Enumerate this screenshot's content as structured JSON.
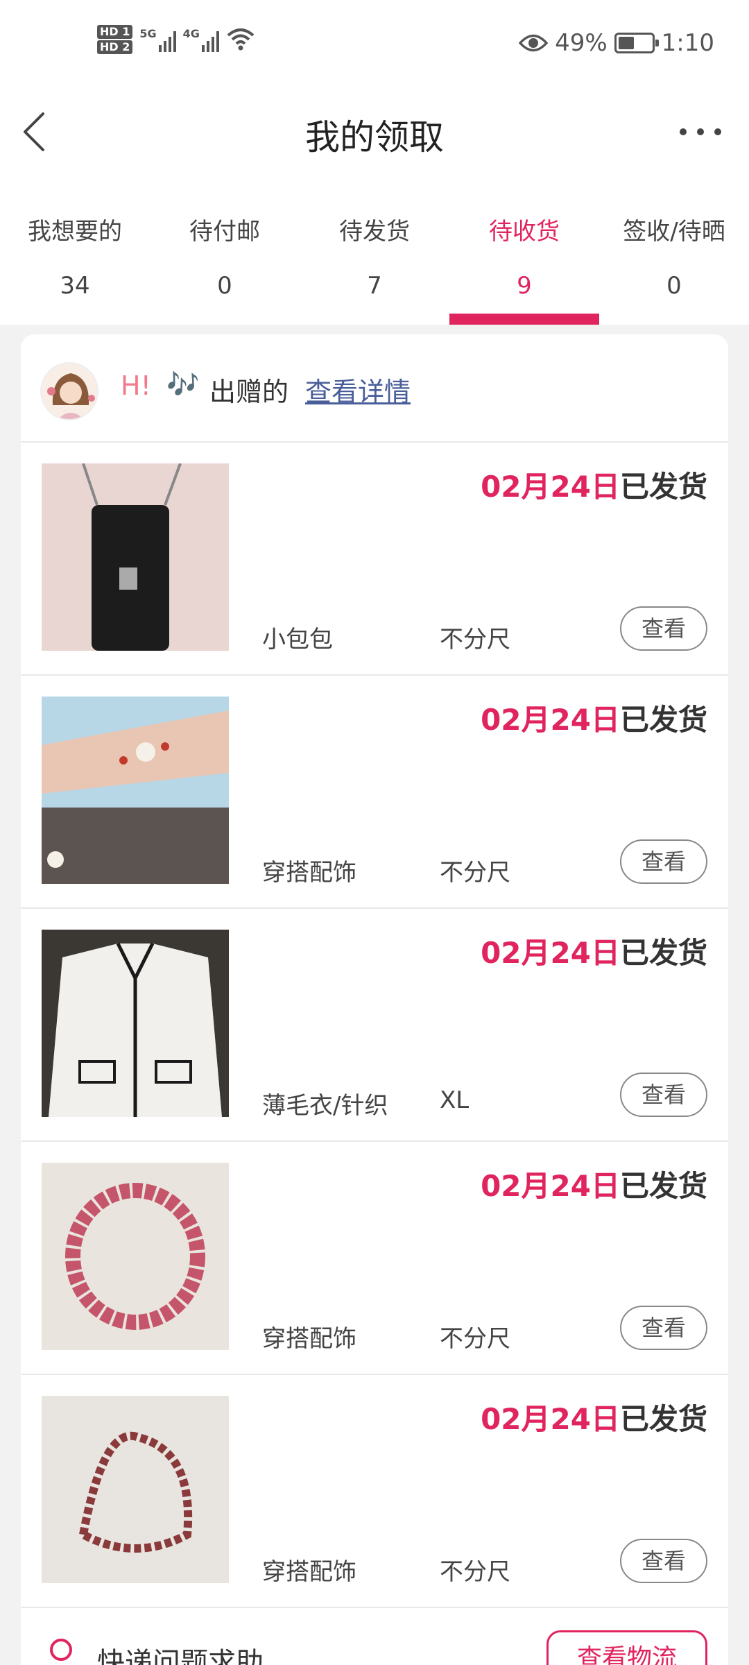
{
  "status_bar": {
    "sim1": "HD 1",
    "sim2": "HD 2",
    "net1": "5G",
    "net2": "4G",
    "battery": "49%",
    "battery_level": 0.49,
    "time": "1:10"
  },
  "header": {
    "title": "我的领取"
  },
  "tabs": [
    {
      "label": "我想要的",
      "count": "34"
    },
    {
      "label": "待付邮",
      "count": "0"
    },
    {
      "label": "待发货",
      "count": "7"
    },
    {
      "label": "待收货",
      "count": "9",
      "active": true
    },
    {
      "label": "签收/待晒",
      "count": "0"
    }
  ],
  "giver": {
    "hi": "H!",
    "note_emoji": "🎶",
    "given_label": "出赠的",
    "detail_link": "查看详情"
  },
  "items": [
    {
      "date": "02月24日",
      "status": "已发货",
      "category": "小包包",
      "size": "不分尺",
      "view_label": "查看",
      "image_icon": "black-crossbody-bag"
    },
    {
      "date": "02月24日",
      "status": "已发货",
      "category": "穿搭配饰",
      "size": "不分尺",
      "view_label": "查看",
      "image_icon": "charm-bracelet-on-wrist"
    },
    {
      "date": "02月24日",
      "status": "已发货",
      "category": "薄毛衣/针织",
      "size": "XL",
      "view_label": "查看",
      "image_icon": "white-knit-cardigan"
    },
    {
      "date": "02月24日",
      "status": "已发货",
      "category": "穿搭配饰",
      "size": "不分尺",
      "view_label": "查看",
      "image_icon": "pink-bead-bracelet"
    },
    {
      "date": "02月24日",
      "status": "已发货",
      "category": "穿搭配饰",
      "size": "不分尺",
      "view_label": "查看",
      "image_icon": "mixed-bead-bracelet"
    }
  ],
  "help": {
    "text": "快递问题求助",
    "logistics_button": "查看物流"
  },
  "colors": {
    "accent": "#e0245e",
    "link": "#4a5f9a",
    "text": "#333333",
    "background": "#f2f2f2"
  }
}
